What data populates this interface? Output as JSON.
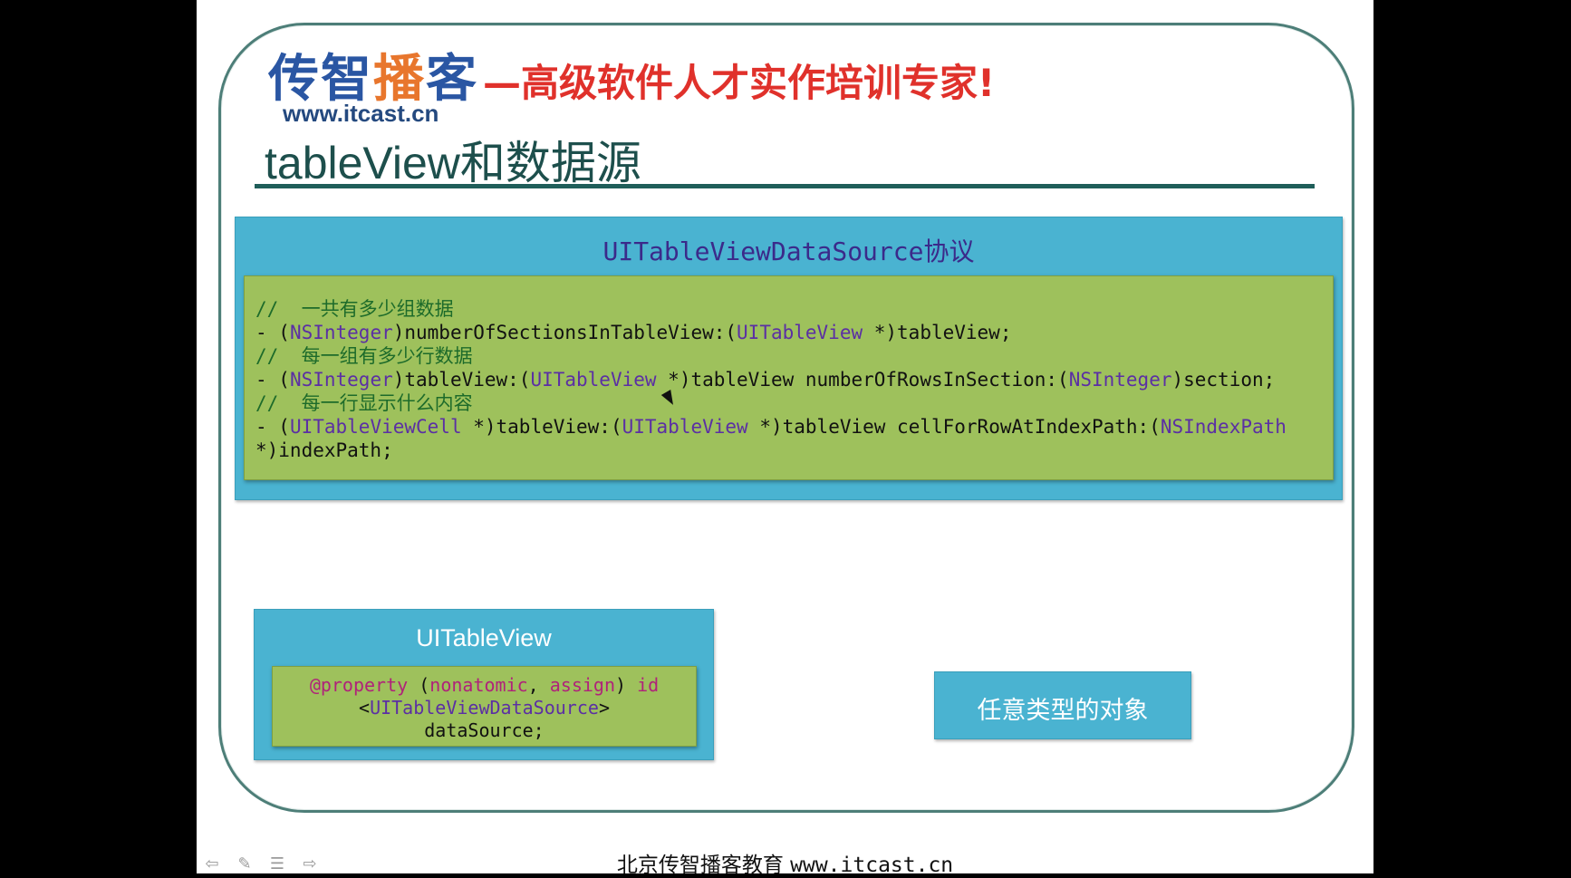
{
  "header": {
    "brand_prefix": "传智",
    "brand_accent": "播",
    "brand_suffix": "客",
    "slogan": "—高级软件人才实作培训专家!",
    "website": "www.itcast.cn",
    "title": "tableView和数据源"
  },
  "protocol_box": {
    "title_code": "UITableViewDataSource",
    "title_cn": "协议",
    "lines": [
      {
        "type": "comment",
        "text": "//  一共有多少组数据"
      },
      {
        "type": "code",
        "parts": [
          "- (",
          "NSInteger",
          ")numberOfSectionsInTableView:(",
          "UITableView",
          " *)tableView;"
        ]
      },
      {
        "type": "comment",
        "text": "//  每一组有多少行数据"
      },
      {
        "type": "code",
        "parts": [
          "- (",
          "NSInteger",
          ")tableView:(",
          "UITableView",
          " *)tableView numberOfRowsInSection:(",
          "NSInteger",
          ")section;"
        ]
      },
      {
        "type": "comment",
        "text": "//  每一行显示什么内容"
      },
      {
        "type": "code",
        "parts": [
          "- (",
          "UITableViewCell",
          " *)tableView:(",
          "UITableView",
          " *)tableView cellForRowAtIndexPath:(",
          "NSIndexPath"
        ]
      },
      {
        "type": "code",
        "parts": [
          "*)indexPath;"
        ]
      }
    ]
  },
  "tableview_box": {
    "title": "UITableView",
    "code_line1_at": "@property",
    "code_line1_open": " (",
    "code_line1_kw1": "nonatomic",
    "code_line1_sep": ", ",
    "code_line1_kw2": "assign",
    "code_line1_close": ") ",
    "code_line1_id": "id",
    "code_line2_open": "<",
    "code_line2_type": "UITableViewDataSource",
    "code_line2_close": ">",
    "code_line3": "dataSource;"
  },
  "object_box": {
    "label": "任意类型的对象"
  },
  "footer": {
    "text": "北京传智播客教育",
    "url": "www.itcast.cn"
  },
  "navigation": {
    "prev_icon": "arrow-left-icon",
    "pen_icon": "pen-icon",
    "menu_icon": "menu-icon",
    "next_icon": "arrow-right-icon"
  },
  "colors": {
    "frame": "#4d7e78",
    "blue_box": "#4ab3d1",
    "green_box": "#9ec15c",
    "brand_blue": "#2a56a3",
    "brand_orange": "#e8762d",
    "slogan_red": "#e0312b"
  }
}
